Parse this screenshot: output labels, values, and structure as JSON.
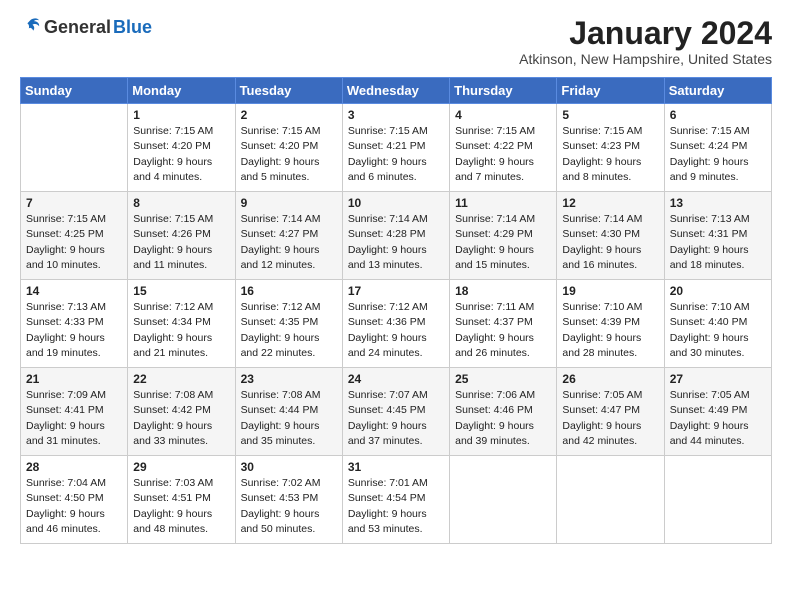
{
  "header": {
    "logo_general": "General",
    "logo_blue": "Blue",
    "month_title": "January 2024",
    "location": "Atkinson, New Hampshire, United States"
  },
  "days_of_week": [
    "Sunday",
    "Monday",
    "Tuesday",
    "Wednesday",
    "Thursday",
    "Friday",
    "Saturday"
  ],
  "weeks": [
    [
      {
        "num": "",
        "info": ""
      },
      {
        "num": "1",
        "info": "Sunrise: 7:15 AM\nSunset: 4:20 PM\nDaylight: 9 hours\nand 4 minutes."
      },
      {
        "num": "2",
        "info": "Sunrise: 7:15 AM\nSunset: 4:20 PM\nDaylight: 9 hours\nand 5 minutes."
      },
      {
        "num": "3",
        "info": "Sunrise: 7:15 AM\nSunset: 4:21 PM\nDaylight: 9 hours\nand 6 minutes."
      },
      {
        "num": "4",
        "info": "Sunrise: 7:15 AM\nSunset: 4:22 PM\nDaylight: 9 hours\nand 7 minutes."
      },
      {
        "num": "5",
        "info": "Sunrise: 7:15 AM\nSunset: 4:23 PM\nDaylight: 9 hours\nand 8 minutes."
      },
      {
        "num": "6",
        "info": "Sunrise: 7:15 AM\nSunset: 4:24 PM\nDaylight: 9 hours\nand 9 minutes."
      }
    ],
    [
      {
        "num": "7",
        "info": "Sunrise: 7:15 AM\nSunset: 4:25 PM\nDaylight: 9 hours\nand 10 minutes."
      },
      {
        "num": "8",
        "info": "Sunrise: 7:15 AM\nSunset: 4:26 PM\nDaylight: 9 hours\nand 11 minutes."
      },
      {
        "num": "9",
        "info": "Sunrise: 7:14 AM\nSunset: 4:27 PM\nDaylight: 9 hours\nand 12 minutes."
      },
      {
        "num": "10",
        "info": "Sunrise: 7:14 AM\nSunset: 4:28 PM\nDaylight: 9 hours\nand 13 minutes."
      },
      {
        "num": "11",
        "info": "Sunrise: 7:14 AM\nSunset: 4:29 PM\nDaylight: 9 hours\nand 15 minutes."
      },
      {
        "num": "12",
        "info": "Sunrise: 7:14 AM\nSunset: 4:30 PM\nDaylight: 9 hours\nand 16 minutes."
      },
      {
        "num": "13",
        "info": "Sunrise: 7:13 AM\nSunset: 4:31 PM\nDaylight: 9 hours\nand 18 minutes."
      }
    ],
    [
      {
        "num": "14",
        "info": "Sunrise: 7:13 AM\nSunset: 4:33 PM\nDaylight: 9 hours\nand 19 minutes."
      },
      {
        "num": "15",
        "info": "Sunrise: 7:12 AM\nSunset: 4:34 PM\nDaylight: 9 hours\nand 21 minutes."
      },
      {
        "num": "16",
        "info": "Sunrise: 7:12 AM\nSunset: 4:35 PM\nDaylight: 9 hours\nand 22 minutes."
      },
      {
        "num": "17",
        "info": "Sunrise: 7:12 AM\nSunset: 4:36 PM\nDaylight: 9 hours\nand 24 minutes."
      },
      {
        "num": "18",
        "info": "Sunrise: 7:11 AM\nSunset: 4:37 PM\nDaylight: 9 hours\nand 26 minutes."
      },
      {
        "num": "19",
        "info": "Sunrise: 7:10 AM\nSunset: 4:39 PM\nDaylight: 9 hours\nand 28 minutes."
      },
      {
        "num": "20",
        "info": "Sunrise: 7:10 AM\nSunset: 4:40 PM\nDaylight: 9 hours\nand 30 minutes."
      }
    ],
    [
      {
        "num": "21",
        "info": "Sunrise: 7:09 AM\nSunset: 4:41 PM\nDaylight: 9 hours\nand 31 minutes."
      },
      {
        "num": "22",
        "info": "Sunrise: 7:08 AM\nSunset: 4:42 PM\nDaylight: 9 hours\nand 33 minutes."
      },
      {
        "num": "23",
        "info": "Sunrise: 7:08 AM\nSunset: 4:44 PM\nDaylight: 9 hours\nand 35 minutes."
      },
      {
        "num": "24",
        "info": "Sunrise: 7:07 AM\nSunset: 4:45 PM\nDaylight: 9 hours\nand 37 minutes."
      },
      {
        "num": "25",
        "info": "Sunrise: 7:06 AM\nSunset: 4:46 PM\nDaylight: 9 hours\nand 39 minutes."
      },
      {
        "num": "26",
        "info": "Sunrise: 7:05 AM\nSunset: 4:47 PM\nDaylight: 9 hours\nand 42 minutes."
      },
      {
        "num": "27",
        "info": "Sunrise: 7:05 AM\nSunset: 4:49 PM\nDaylight: 9 hours\nand 44 minutes."
      }
    ],
    [
      {
        "num": "28",
        "info": "Sunrise: 7:04 AM\nSunset: 4:50 PM\nDaylight: 9 hours\nand 46 minutes."
      },
      {
        "num": "29",
        "info": "Sunrise: 7:03 AM\nSunset: 4:51 PM\nDaylight: 9 hours\nand 48 minutes."
      },
      {
        "num": "30",
        "info": "Sunrise: 7:02 AM\nSunset: 4:53 PM\nDaylight: 9 hours\nand 50 minutes."
      },
      {
        "num": "31",
        "info": "Sunrise: 7:01 AM\nSunset: 4:54 PM\nDaylight: 9 hours\nand 53 minutes."
      },
      {
        "num": "",
        "info": ""
      },
      {
        "num": "",
        "info": ""
      },
      {
        "num": "",
        "info": ""
      }
    ]
  ]
}
